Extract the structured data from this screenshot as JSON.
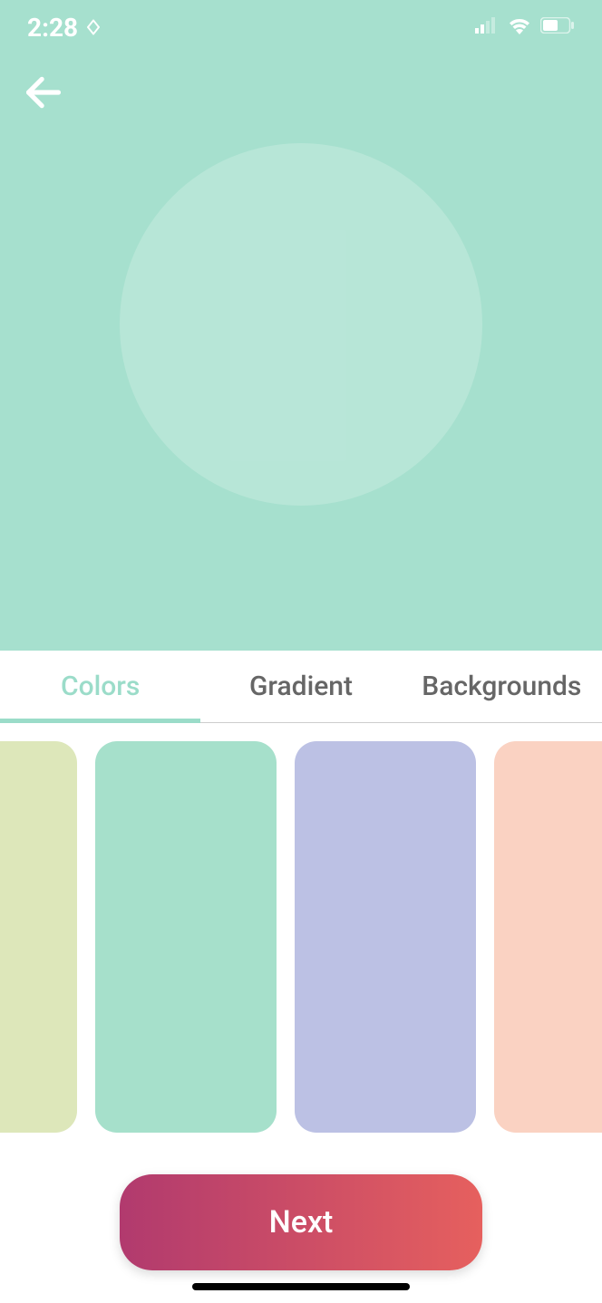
{
  "status": {
    "time": "2:28"
  },
  "preview": {
    "background_color": "#A6E0CE",
    "circle_color": "rgba(255,255,255,0.2)"
  },
  "tabs": [
    {
      "label": "Colors",
      "active": true
    },
    {
      "label": "Gradient",
      "active": false
    },
    {
      "label": "Backgrounds",
      "active": false
    }
  ],
  "swatches": [
    {
      "color": "#DDE7BA"
    },
    {
      "color": "#A6E0CB"
    },
    {
      "color": "#BCC1E4"
    },
    {
      "color": "#FAD2C2"
    }
  ],
  "next_button": {
    "label": "Next"
  }
}
